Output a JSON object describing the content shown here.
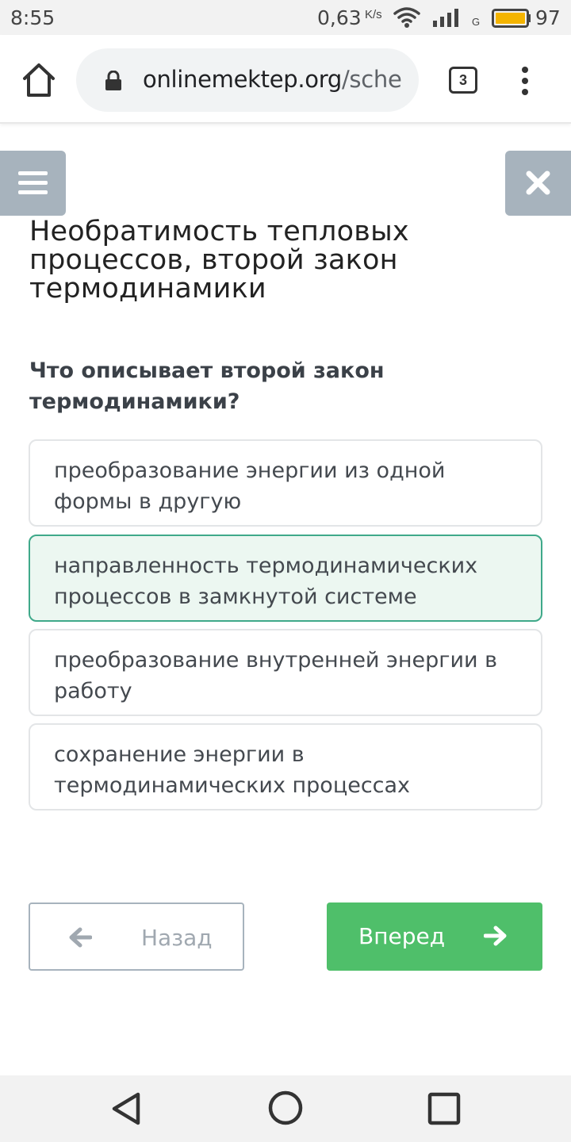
{
  "status_bar": {
    "time": "8:55",
    "net_speed": "0,63",
    "net_speed_unit": "K/s",
    "network_type": "G",
    "battery": "97",
    "battery_color": "#f4b400"
  },
  "browser": {
    "url_domain": "onlinemektep.org",
    "url_path": "/sche",
    "tab_count": "3",
    "icons": [
      "home-icon",
      "lock-icon",
      "tabs-icon",
      "menu-icon"
    ]
  },
  "page": {
    "lesson_title": "Необратимость тепловых процессов, второй закон термодинамики",
    "question": "Что описывает второй закон термодинамики?",
    "options": [
      {
        "label": "преобразование энергии из одной формы в другую",
        "selected": false
      },
      {
        "label": "направленность термодинамических процессов в замкнутой системе",
        "selected": true
      },
      {
        "label": "преобразование внутренней энергии в работу",
        "selected": false
      },
      {
        "label": "сохранение энергии в термодинамических процессах",
        "selected": false
      }
    ],
    "back_label": "Назад",
    "next_label": "Вперед",
    "colors": {
      "accent_green": "#4fbf6a",
      "selected_border": "#3fa98a",
      "header_button": "#a7b3bd"
    }
  },
  "nav_bar": {
    "icons": [
      "back-triangle-icon",
      "home-circle-icon",
      "recent-square-icon"
    ]
  }
}
